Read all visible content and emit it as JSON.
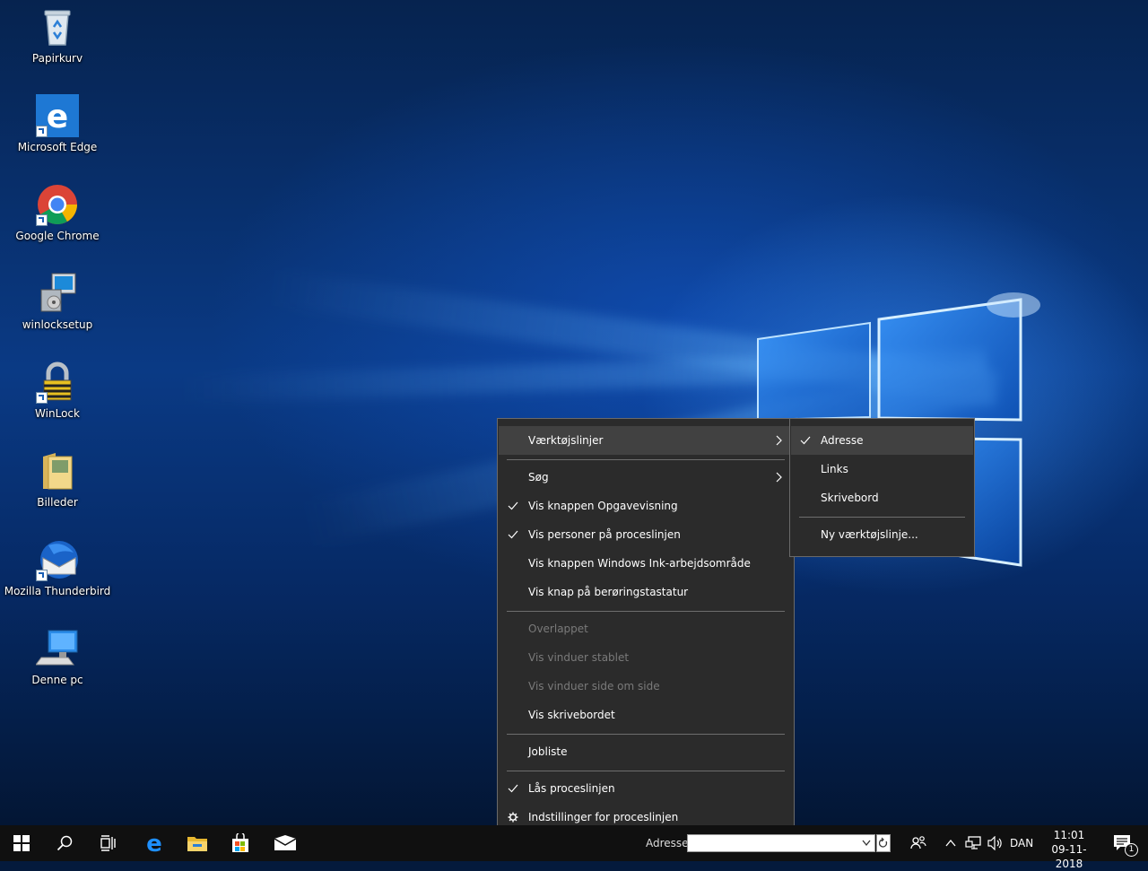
{
  "desktop": {
    "icons": [
      {
        "label": "Papirkurv",
        "icon": "recycle-bin-icon"
      },
      {
        "label": "Microsoft Edge",
        "icon": "edge-icon"
      },
      {
        "label": "Google Chrome",
        "icon": "chrome-icon"
      },
      {
        "label": "winlocksetup",
        "icon": "installer-icon"
      },
      {
        "label": "WinLock",
        "icon": "padlock-icon"
      },
      {
        "label": "Billeder",
        "icon": "folder-pictures-icon"
      },
      {
        "label": "Mozilla Thunderbird",
        "icon": "thunderbird-icon"
      },
      {
        "label": "Denne pc",
        "icon": "computer-icon"
      }
    ]
  },
  "context_menu": {
    "toolbars": "Værktøjslinjer",
    "search": "Søg",
    "task_view": "Vis knappen Opgavevisning",
    "people": "Vis personer på proceslinjen",
    "ink": "Vis knappen Windows Ink-arbejdsområde",
    "touch_keyboard": "Vis knap på berøringstastatur",
    "cascade": "Overlappet",
    "stacked": "Vis vinduer stablet",
    "side_by_side": "Vis vinduer side om side",
    "show_desktop": "Vis skrivebordet",
    "task_manager": "Jobliste",
    "lock_taskbar": "Lås proceslinjen",
    "settings": "Indstillinger for proceslinjen"
  },
  "submenu": {
    "address": "Adresse",
    "links": "Links",
    "desktop": "Skrivebord",
    "new_toolbar": "Ny værktøjslinje..."
  },
  "taskbar": {
    "address_label": "Adresse",
    "address_value": "",
    "language": "DAN",
    "time": "11:01",
    "date": "09-11-2018",
    "notification_count": "1"
  },
  "colors": {
    "menu_bg": "#2b2b2b",
    "menu_highlight": "#414141",
    "taskbar_bg": "#101010",
    "accent": "#0078d7"
  }
}
